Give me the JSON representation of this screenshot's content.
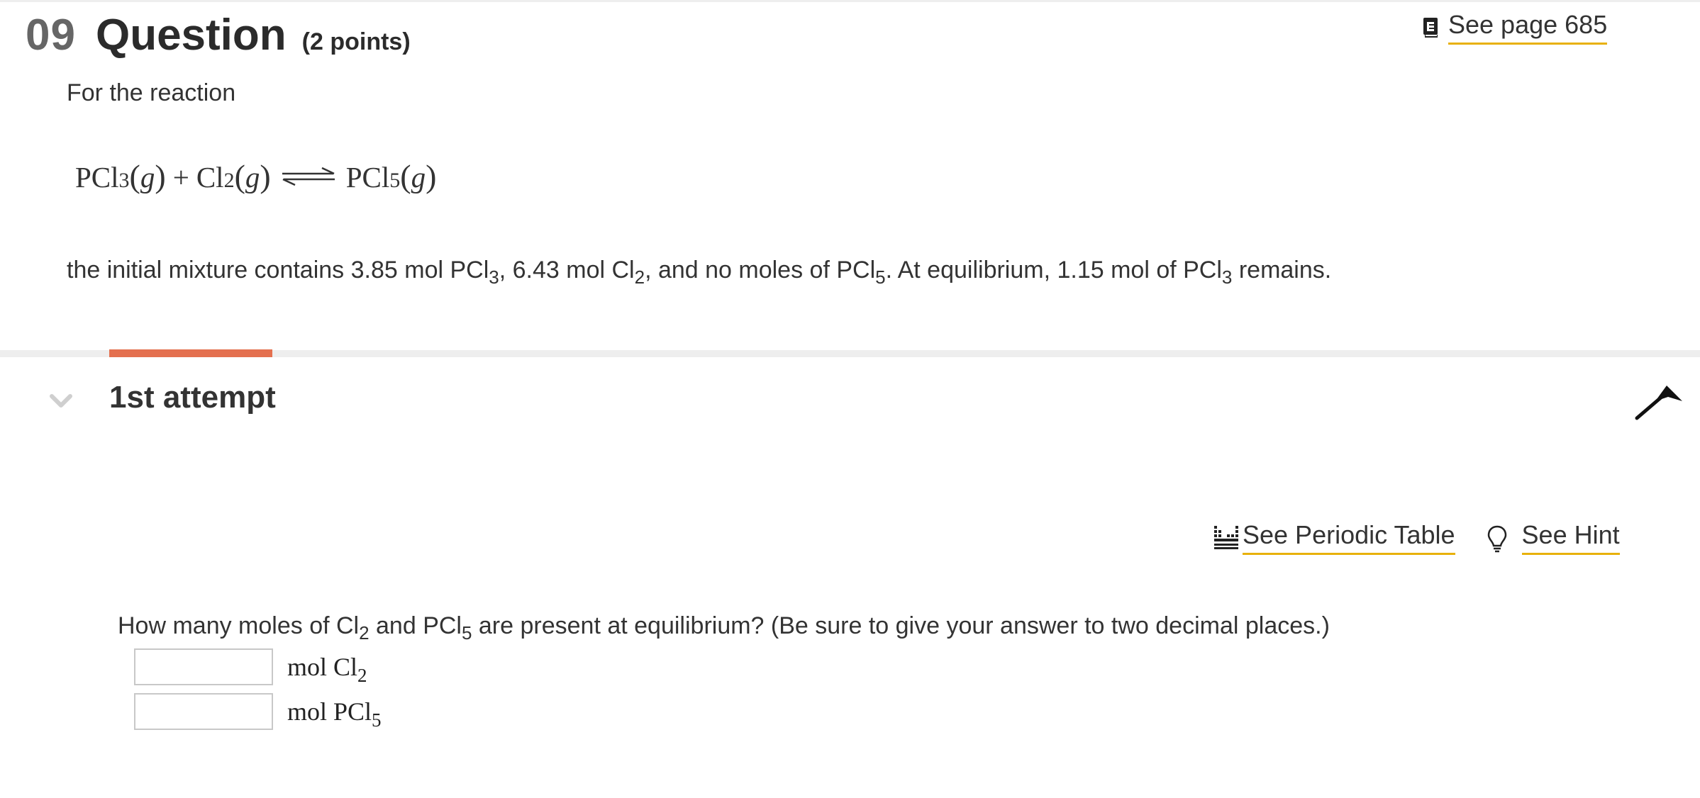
{
  "question": {
    "number": "09",
    "title": "Question",
    "points": "(2 points)",
    "see_page": "See page 685"
  },
  "reaction": {
    "intro": "For the reaction",
    "equation": {
      "reactant1": "PCl",
      "reactant1_sub": "3",
      "state1": "g",
      "plus": "+",
      "reactant2": "Cl",
      "reactant2_sub": "2",
      "state2": "g",
      "product": "PCl",
      "product_sub": "5",
      "state3": "g"
    },
    "statement": {
      "p1": "the initial mixture contains 3.85 mol PCl",
      "s1": "3",
      "p2": ", 6.43 mol Cl",
      "s2": "2",
      "p3": ", and no moles of PCl",
      "s3": "5",
      "p4": ". At equilibrium, 1.15 mol of PCl",
      "s4": "3",
      "p5": "remains."
    }
  },
  "attempt": {
    "title": "1st attempt",
    "accent_color": "#e4704f"
  },
  "tools": {
    "periodic_table": "See Periodic Table",
    "hint": "See Hint",
    "link_underline_color": "#e8b10b"
  },
  "prompt": {
    "p1": "How many moles of Cl",
    "s1": "2",
    "p2": " and PCl",
    "s2": "5",
    "p3": " are present at equilibrium? (Be sure to give your answer to two decimal places.)"
  },
  "answers": [
    {
      "value": "",
      "unit": "mol Cl",
      "unit_sub": "2"
    },
    {
      "value": "",
      "unit": "mol PCl",
      "unit_sub": "5"
    }
  ],
  "icons": {
    "book": "book-icon",
    "chevron": "chevron-down-icon",
    "flag": "flag-icon",
    "periodic_table": "periodic-table-icon",
    "hint": "lightbulb-icon"
  }
}
